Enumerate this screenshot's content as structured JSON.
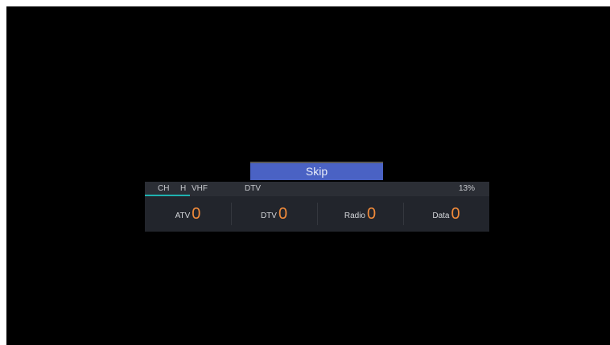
{
  "skip_button": {
    "label": "Skip"
  },
  "scan_header": {
    "channel_label": "CH",
    "polarity": "H",
    "band": "VHF",
    "scan_type": "DTV",
    "progress_percent_text": "13%",
    "progress_fraction": 0.13
  },
  "counters": [
    {
      "label": "ATV",
      "value": "0"
    },
    {
      "label": "DTV",
      "value": "0"
    },
    {
      "label": "Radio",
      "value": "0"
    },
    {
      "label": "Data",
      "value": "0"
    }
  ],
  "colors": {
    "accent_progress": "#1fb2b0",
    "count_value": "#f08a3a",
    "skip_button": "#4a62c4",
    "panel": "#22252c"
  }
}
